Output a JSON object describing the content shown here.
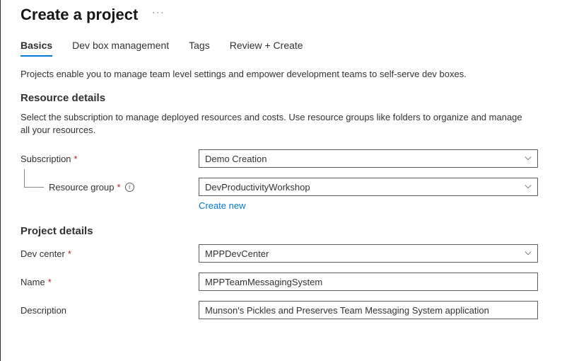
{
  "header": {
    "title": "Create a project",
    "more": "···"
  },
  "tabs": {
    "basics": "Basics",
    "devbox": "Dev box management",
    "tags": "Tags",
    "review": "Review + Create"
  },
  "intro": "Projects enable you to manage team level settings and empower development teams to self-serve dev boxes.",
  "resource": {
    "title": "Resource details",
    "desc": "Select the subscription to manage deployed resources and costs. Use resource groups like folders to organize and manage all your resources.",
    "subscription_label": "Subscription",
    "subscription_value": "Demo Creation",
    "resource_group_label": "Resource group",
    "resource_group_value": "DevProductivityWorkshop",
    "create_new": "Create new"
  },
  "project": {
    "title": "Project details",
    "devcenter_label": "Dev center",
    "devcenter_value": "MPPDevCenter",
    "name_label": "Name",
    "name_value": "MPPTeamMessagingSystem",
    "description_label": "Description",
    "description_value": "Munson's Pickles and Preserves Team Messaging System application"
  }
}
